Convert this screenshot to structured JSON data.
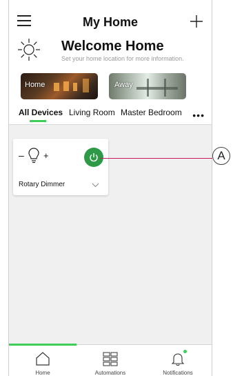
{
  "header": {
    "title": "My Home",
    "welcome": "Welcome Home",
    "subtitle": "Set your home location for more information."
  },
  "scenes": [
    {
      "label": "Home"
    },
    {
      "label": "Away"
    }
  ],
  "tabs": [
    {
      "label": "All Devices",
      "active": true
    },
    {
      "label": "Living Room"
    },
    {
      "label": "Master Bedroom"
    }
  ],
  "more": "•••",
  "device_card": {
    "name": "Rotary Dimmer",
    "minus": "–",
    "plus": "+",
    "power_color": "#2e9a48"
  },
  "bottom_nav": [
    {
      "label": "Home",
      "icon": "house-icon",
      "active": true
    },
    {
      "label": "Automations",
      "icon": "grid-icon"
    },
    {
      "label": "Notifications",
      "icon": "bell-icon"
    }
  ],
  "callout": {
    "label": "A",
    "color": "#c8185b"
  },
  "colors": {
    "accent": "#3dcd58",
    "background": "#f0f0f0"
  }
}
